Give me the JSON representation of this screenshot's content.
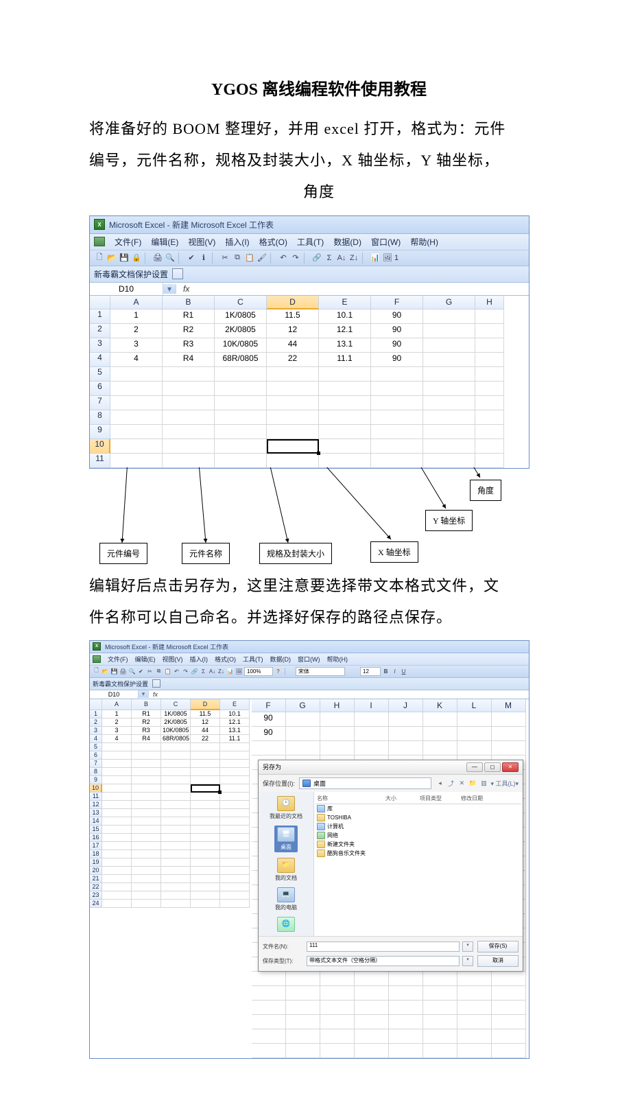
{
  "doc": {
    "title": "YGOS 离线编程软件使用教程",
    "para1a": "将准备好的 BOOM 整理好，并用 excel 打开，格式为：元件",
    "para1b": "编号，元件名称，规格及封装大小，X 轴坐标，Y 轴坐标，",
    "para1c": "角度",
    "para2a": "编辑好后点击另存为，这里注意要选择带文本格式文件，文",
    "para2b": "件名称可以自己命名。并选择好保存的路径点保存。"
  },
  "excel": {
    "app_title": "Microsoft Excel - 新建 Microsoft Excel 工作表",
    "menu": {
      "file": "文件(F)",
      "edit": "编辑(E)",
      "view": "视图(V)",
      "insert": "插入(I)",
      "format": "格式(O)",
      "tools": "工具(T)",
      "data": "数据(D)",
      "window": "窗口(W)",
      "help": "帮助(H)"
    },
    "protect_bar": "新毒霸文档保护设置",
    "namebox": "D10",
    "fx": "fx",
    "cols": [
      "A",
      "B",
      "C",
      "D",
      "E",
      "F",
      "G",
      "H"
    ],
    "row_count_1": 11,
    "data_rows": [
      [
        "1",
        "R1",
        "1K/0805",
        "11.5",
        "10.1",
        "90"
      ],
      [
        "2",
        "R2",
        "2K/0805",
        "12",
        "12.1",
        "90"
      ],
      [
        "3",
        "R3",
        "10K/0805",
        "44",
        "13.1",
        "90"
      ],
      [
        "4",
        "R4",
        "68R/0805",
        "22",
        "11.1",
        "90"
      ]
    ],
    "toolbar_font": "宋体",
    "toolbar_fontsize": "12",
    "toolbar_zoom": "100%",
    "cols2": [
      "A",
      "B",
      "C",
      "D",
      "E",
      "F",
      "G",
      "H",
      "I",
      "J",
      "K",
      "L",
      "M"
    ]
  },
  "annot": {
    "box1": "元件编号",
    "box2": "元件名称",
    "box3": "规格及封装大小",
    "box4": "X 轴坐标",
    "box5": "Y 轴坐标",
    "box6": "角度"
  },
  "saveas": {
    "title": "另存为",
    "loc_label": "保存位置(I):",
    "loc_value": "桌面",
    "tools_label": "▾ 工具(L)▾",
    "fl_hdr": {
      "name": "名称",
      "size": "大小",
      "type": "项目类型",
      "date": "修改日期"
    },
    "items": [
      {
        "name": "库",
        "cls": "blue"
      },
      {
        "name": "TOSHIBA",
        "cls": ""
      },
      {
        "name": "计算机",
        "cls": "blue"
      },
      {
        "name": "网络",
        "cls": "db"
      },
      {
        "name": "新建文件夹",
        "cls": ""
      },
      {
        "name": "酷狗音乐文件夹",
        "cls": ""
      }
    ],
    "places": {
      "recent": "我最近的文档",
      "desktop": "桌面",
      "mydocs": "我的文档",
      "mycomp": "我的电脑"
    },
    "filename_label": "文件名(N):",
    "filename_value": "111",
    "filetype_label": "保存类型(T):",
    "filetype_value": "带格式文本文件（空格分隔）",
    "save_btn": "保存(S)",
    "cancel_btn": "取消"
  }
}
